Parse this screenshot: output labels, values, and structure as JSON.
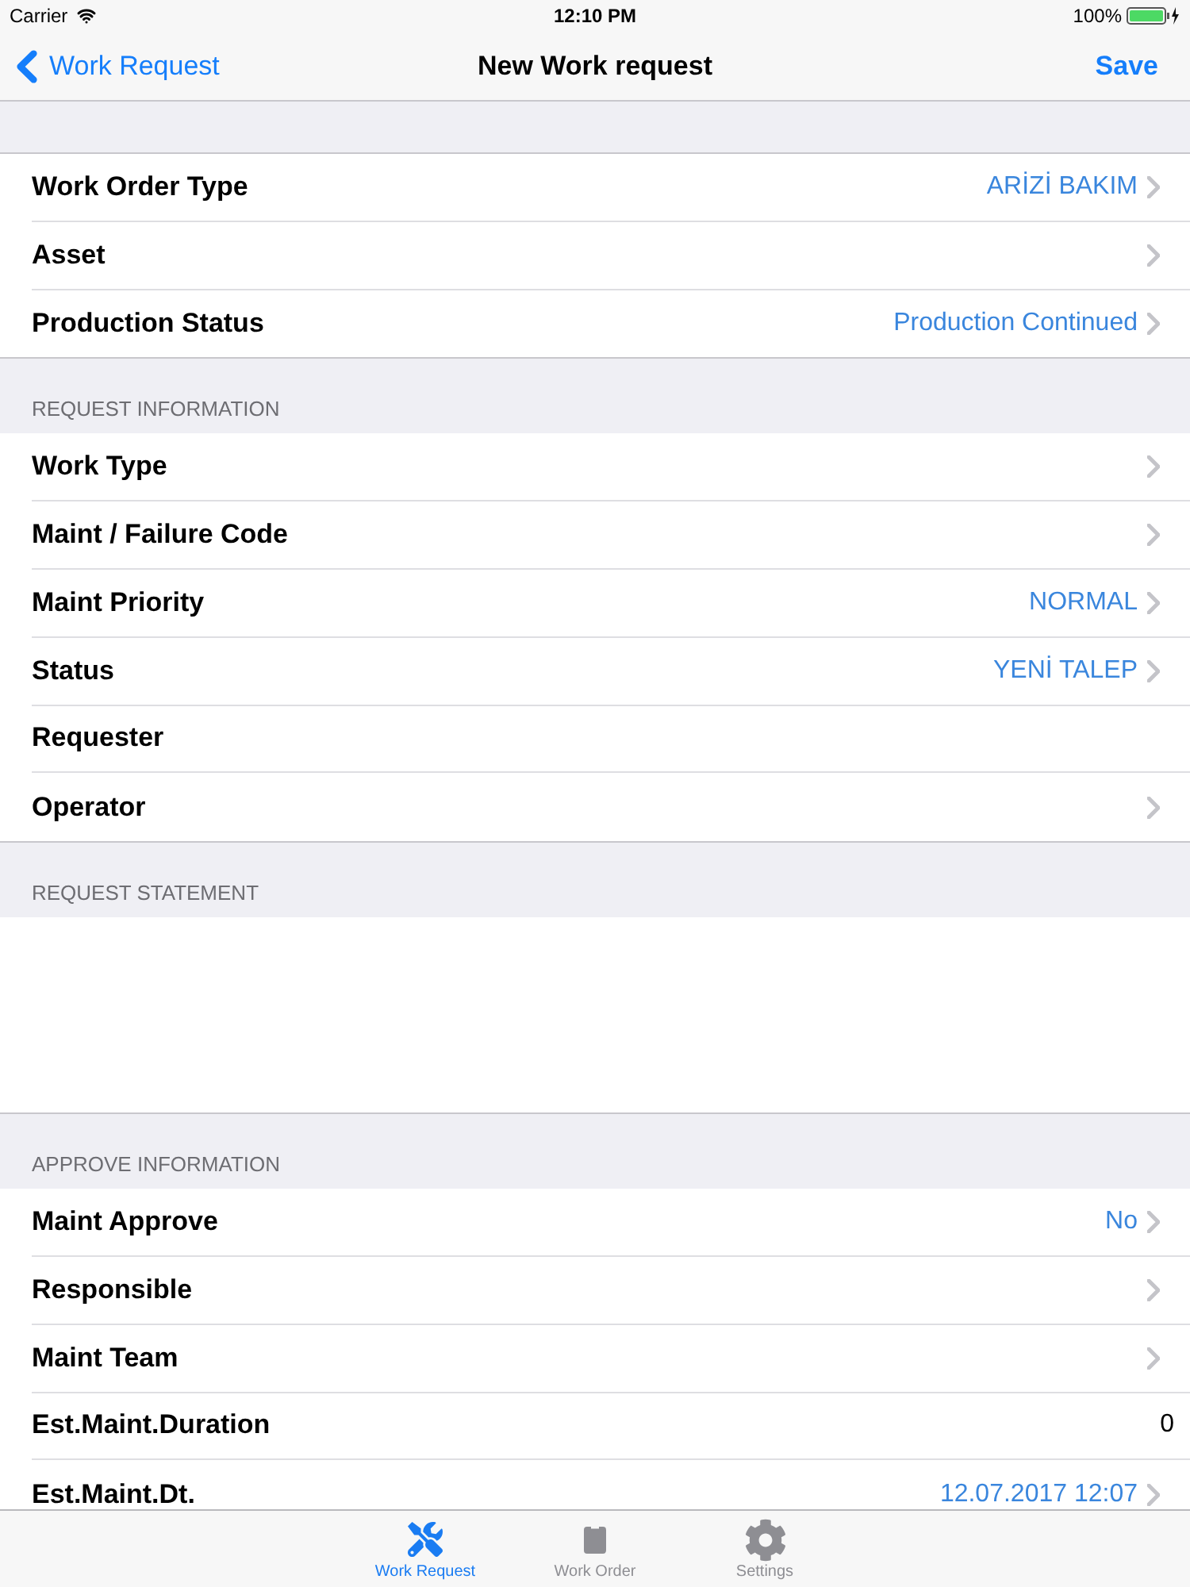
{
  "status_bar": {
    "carrier": "Carrier",
    "time": "12:10 PM",
    "battery": "100%"
  },
  "nav_bar": {
    "back": "Work Request",
    "title": "New Work request",
    "action": "Save"
  },
  "sections": [
    {
      "kind": "list",
      "rows": [
        {
          "kind": "select",
          "label": "Work Order Type",
          "value": "ARİZİ BAKIM"
        },
        {
          "kind": "select",
          "label": "Asset"
        },
        {
          "kind": "select",
          "label": "Production Status",
          "value": "Production Continued"
        }
      ]
    },
    {
      "kind": "list",
      "header": "REQUEST INFORMATION",
      "rows": [
        {
          "kind": "select",
          "label": "Work Type"
        },
        {
          "kind": "select",
          "label": "Maint / Failure Code"
        },
        {
          "kind": "select",
          "label": "Maint Priority",
          "value": "NORMAL"
        },
        {
          "kind": "select",
          "label": "Status",
          "value": "YENİ TALEP"
        },
        {
          "kind": "text",
          "label": "Requester"
        },
        {
          "kind": "select",
          "label": "Operator"
        }
      ]
    },
    {
      "kind": "note",
      "header": "REQUEST STATEMENT"
    },
    {
      "kind": "list",
      "header": "APPROVE INFORMATION",
      "rows": [
        {
          "kind": "select",
          "label": "Maint Approve",
          "value": "No"
        },
        {
          "kind": "select",
          "label": "Responsible"
        },
        {
          "kind": "select",
          "label": "Maint Team"
        },
        {
          "kind": "text",
          "label": "Est.Maint.Duration",
          "value": "0"
        },
        {
          "kind": "select",
          "label": "Est.Maint.Dt.",
          "value": "12.07.2017 12:07"
        }
      ]
    }
  ],
  "tab_bar": [
    {
      "label": "Work Request",
      "selected": true
    },
    {
      "label": "Work Order",
      "selected": false
    },
    {
      "label": "Settings",
      "selected": false
    }
  ]
}
